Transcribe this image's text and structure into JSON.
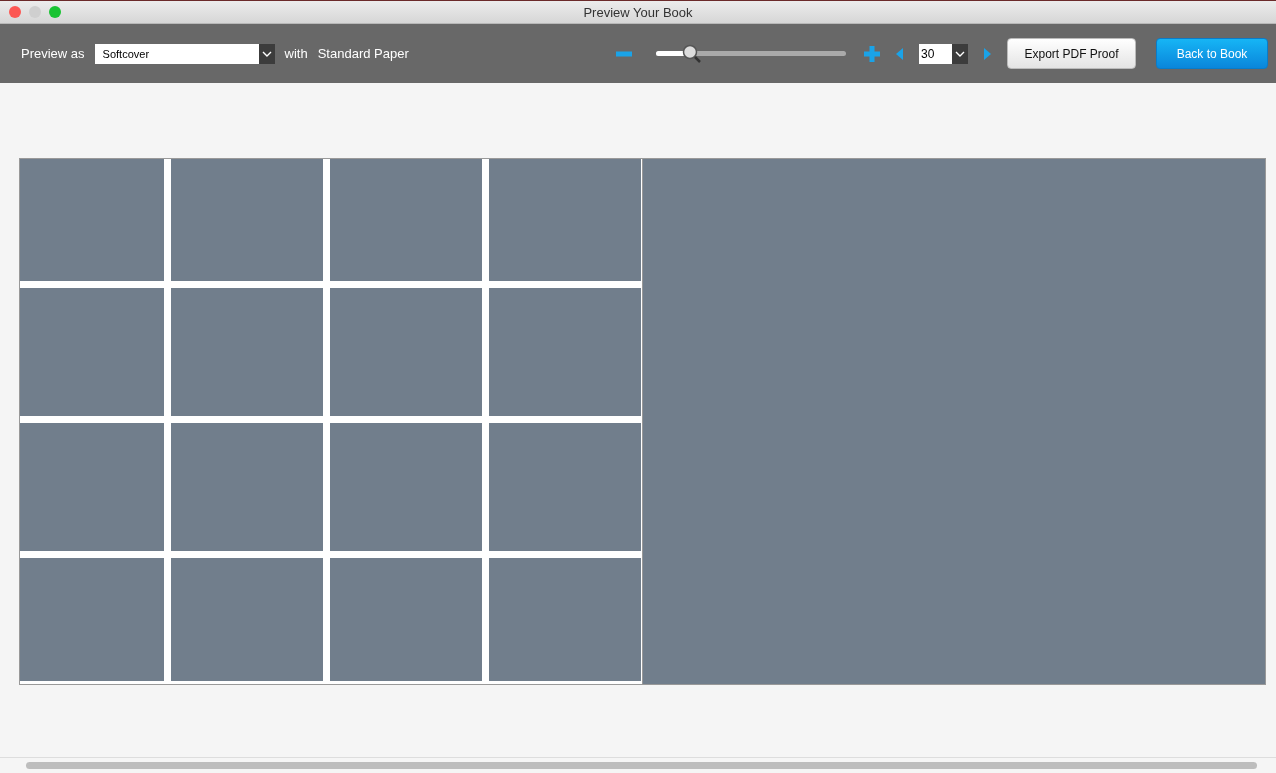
{
  "window": {
    "title": "Preview Your Book"
  },
  "toolbar": {
    "preview_label": "Preview as",
    "cover_select": {
      "value": "Softcover"
    },
    "with_label": "with",
    "paper": "Standard Paper",
    "zoom": {
      "level": 0.17
    },
    "page_select": {
      "value": "30"
    },
    "export_button": "Export PDF Proof",
    "back_button": "Back to Book"
  },
  "spread": {
    "left_page": {
      "slots": [
        {
          "kind": "placeholder"
        },
        {
          "kind": "placeholder"
        },
        {
          "kind": "placeholder"
        },
        {
          "kind": "placeholder"
        },
        {
          "kind": "placeholder"
        },
        {
          "kind": "placeholder"
        },
        {
          "kind": "placeholder"
        },
        {
          "kind": "placeholder"
        },
        {
          "kind": "placeholder"
        },
        {
          "kind": "placeholder"
        },
        {
          "kind": "placeholder"
        },
        {
          "kind": "placeholder"
        },
        {
          "kind": "placeholder"
        },
        {
          "kind": "placeholder"
        },
        {
          "kind": "placeholder"
        },
        {
          "kind": "placeholder"
        }
      ]
    },
    "right_page": {
      "kind": "placeholder"
    }
  }
}
